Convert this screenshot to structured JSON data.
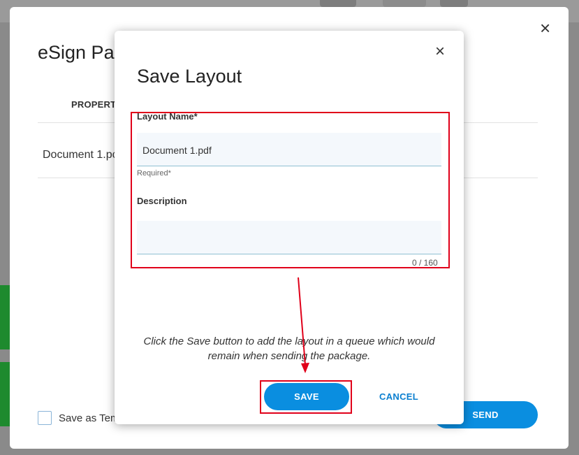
{
  "background_dialog": {
    "title": "eSign Pac",
    "close_icon": "×",
    "column_header": "PROPERT",
    "row_document": "Document 1.pc",
    "save_template_label": "Save as Tem",
    "send_label": "SEND"
  },
  "save_layout_dialog": {
    "title": "Save Layout",
    "close_icon": "×",
    "layout_name_label": "Layout Name*",
    "layout_name_value": "Document 1.pdf",
    "required_hint": "Required*",
    "description_label": "Description",
    "description_value": "",
    "char_counter": "0 / 160",
    "instruction_text": "Click the Save button to add the layout in a queue which would remain when sending the package.",
    "save_label": "SAVE",
    "cancel_label": "CANCEL"
  },
  "colors": {
    "primary_button": "#0a8ee0",
    "annotation": "#e0001a",
    "overlay": "#8a8a8a",
    "side_tab_green": "#1e8a2e"
  },
  "icons": [
    "close-icon",
    "checkbox-icon"
  ]
}
